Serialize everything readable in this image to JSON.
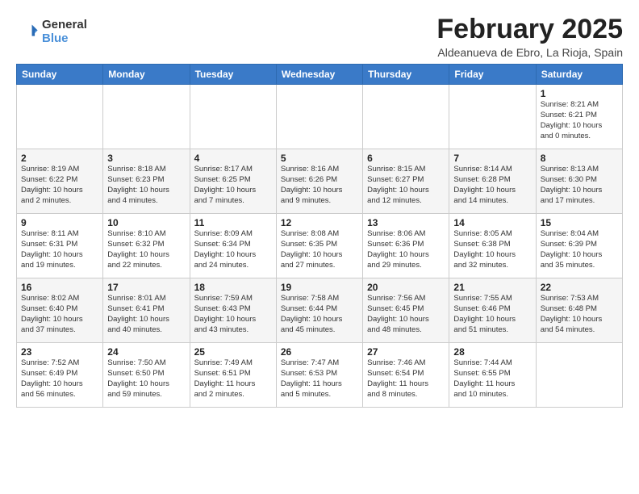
{
  "header": {
    "logo_line1": "General",
    "logo_line2": "Blue",
    "month": "February 2025",
    "location": "Aldeanueva de Ebro, La Rioja, Spain"
  },
  "weekdays": [
    "Sunday",
    "Monday",
    "Tuesday",
    "Wednesday",
    "Thursday",
    "Friday",
    "Saturday"
  ],
  "weeks": [
    [
      {
        "day": "",
        "info": ""
      },
      {
        "day": "",
        "info": ""
      },
      {
        "day": "",
        "info": ""
      },
      {
        "day": "",
        "info": ""
      },
      {
        "day": "",
        "info": ""
      },
      {
        "day": "",
        "info": ""
      },
      {
        "day": "1",
        "info": "Sunrise: 8:21 AM\nSunset: 6:21 PM\nDaylight: 10 hours\nand 0 minutes."
      }
    ],
    [
      {
        "day": "2",
        "info": "Sunrise: 8:19 AM\nSunset: 6:22 PM\nDaylight: 10 hours\nand 2 minutes."
      },
      {
        "day": "3",
        "info": "Sunrise: 8:18 AM\nSunset: 6:23 PM\nDaylight: 10 hours\nand 4 minutes."
      },
      {
        "day": "4",
        "info": "Sunrise: 8:17 AM\nSunset: 6:25 PM\nDaylight: 10 hours\nand 7 minutes."
      },
      {
        "day": "5",
        "info": "Sunrise: 8:16 AM\nSunset: 6:26 PM\nDaylight: 10 hours\nand 9 minutes."
      },
      {
        "day": "6",
        "info": "Sunrise: 8:15 AM\nSunset: 6:27 PM\nDaylight: 10 hours\nand 12 minutes."
      },
      {
        "day": "7",
        "info": "Sunrise: 8:14 AM\nSunset: 6:28 PM\nDaylight: 10 hours\nand 14 minutes."
      },
      {
        "day": "8",
        "info": "Sunrise: 8:13 AM\nSunset: 6:30 PM\nDaylight: 10 hours\nand 17 minutes."
      }
    ],
    [
      {
        "day": "9",
        "info": "Sunrise: 8:11 AM\nSunset: 6:31 PM\nDaylight: 10 hours\nand 19 minutes."
      },
      {
        "day": "10",
        "info": "Sunrise: 8:10 AM\nSunset: 6:32 PM\nDaylight: 10 hours\nand 22 minutes."
      },
      {
        "day": "11",
        "info": "Sunrise: 8:09 AM\nSunset: 6:34 PM\nDaylight: 10 hours\nand 24 minutes."
      },
      {
        "day": "12",
        "info": "Sunrise: 8:08 AM\nSunset: 6:35 PM\nDaylight: 10 hours\nand 27 minutes."
      },
      {
        "day": "13",
        "info": "Sunrise: 8:06 AM\nSunset: 6:36 PM\nDaylight: 10 hours\nand 29 minutes."
      },
      {
        "day": "14",
        "info": "Sunrise: 8:05 AM\nSunset: 6:38 PM\nDaylight: 10 hours\nand 32 minutes."
      },
      {
        "day": "15",
        "info": "Sunrise: 8:04 AM\nSunset: 6:39 PM\nDaylight: 10 hours\nand 35 minutes."
      }
    ],
    [
      {
        "day": "16",
        "info": "Sunrise: 8:02 AM\nSunset: 6:40 PM\nDaylight: 10 hours\nand 37 minutes."
      },
      {
        "day": "17",
        "info": "Sunrise: 8:01 AM\nSunset: 6:41 PM\nDaylight: 10 hours\nand 40 minutes."
      },
      {
        "day": "18",
        "info": "Sunrise: 7:59 AM\nSunset: 6:43 PM\nDaylight: 10 hours\nand 43 minutes."
      },
      {
        "day": "19",
        "info": "Sunrise: 7:58 AM\nSunset: 6:44 PM\nDaylight: 10 hours\nand 45 minutes."
      },
      {
        "day": "20",
        "info": "Sunrise: 7:56 AM\nSunset: 6:45 PM\nDaylight: 10 hours\nand 48 minutes."
      },
      {
        "day": "21",
        "info": "Sunrise: 7:55 AM\nSunset: 6:46 PM\nDaylight: 10 hours\nand 51 minutes."
      },
      {
        "day": "22",
        "info": "Sunrise: 7:53 AM\nSunset: 6:48 PM\nDaylight: 10 hours\nand 54 minutes."
      }
    ],
    [
      {
        "day": "23",
        "info": "Sunrise: 7:52 AM\nSunset: 6:49 PM\nDaylight: 10 hours\nand 56 minutes."
      },
      {
        "day": "24",
        "info": "Sunrise: 7:50 AM\nSunset: 6:50 PM\nDaylight: 10 hours\nand 59 minutes."
      },
      {
        "day": "25",
        "info": "Sunrise: 7:49 AM\nSunset: 6:51 PM\nDaylight: 11 hours\nand 2 minutes."
      },
      {
        "day": "26",
        "info": "Sunrise: 7:47 AM\nSunset: 6:53 PM\nDaylight: 11 hours\nand 5 minutes."
      },
      {
        "day": "27",
        "info": "Sunrise: 7:46 AM\nSunset: 6:54 PM\nDaylight: 11 hours\nand 8 minutes."
      },
      {
        "day": "28",
        "info": "Sunrise: 7:44 AM\nSunset: 6:55 PM\nDaylight: 11 hours\nand 10 minutes."
      },
      {
        "day": "",
        "info": ""
      }
    ]
  ]
}
